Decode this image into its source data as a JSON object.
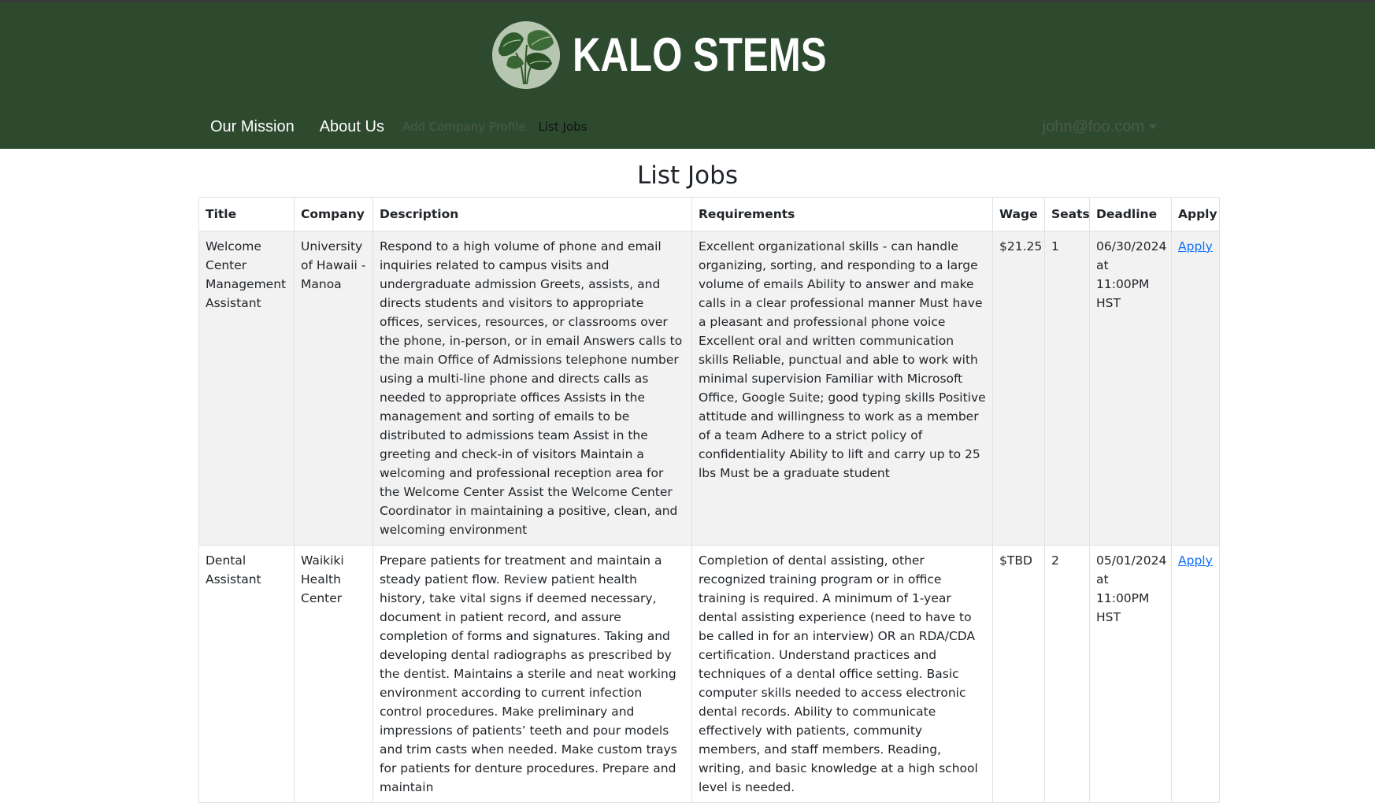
{
  "brand": {
    "name": "KALO STEMS",
    "logo_icon": "taro-leaf-icon"
  },
  "nav": {
    "our_mission": "Our Mission",
    "about_us": "About Us",
    "add_company_profile": "Add Company Profile",
    "list_jobs": "List Jobs",
    "user_email": "john@foo.com"
  },
  "page": {
    "title": "List Jobs"
  },
  "table": {
    "headers": [
      "Title",
      "Company",
      "Description",
      "Requirements",
      "Wage",
      "Seats",
      "Deadline",
      "Apply"
    ],
    "rows": [
      {
        "title": "Welcome Center Management Assistant",
        "company": "University of Hawaii - Manoa",
        "description": "Respond to a high volume of phone and email inquiries related to campus visits and undergraduate admission Greets, assists, and directs students and visitors to appropriate offices, services, resources, or classrooms over the phone, in-person, or in email Answers calls to the main Office of Admissions telephone number using a multi-line phone and directs calls as needed to appropriate offices Assists in the management and sorting of emails to be distributed to admissions team Assist in the greeting and check-in of visitors Maintain a welcoming and professional reception area for the Welcome Center Assist the Welcome Center Coordinator in maintaining a positive, clean, and welcoming environment",
        "requirements": "Excellent organizational skills - can handle organizing, sorting, and responding to a large volume of emails Ability to answer and make calls in a clear professional manner Must have a pleasant and professional phone voice Excellent oral and written communication skills Reliable, punctual and able to work with minimal supervision Familiar with Microsoft Office, Google Suite; good typing skills Positive attitude and willingness to work as a member of a team Adhere to a strict policy of confidentiality Ability to lift and carry up to 25 lbs Must be a graduate student",
        "wage": "$21.25",
        "seats": "1",
        "deadline": "06/30/2024 at 11:00PM HST",
        "apply": "Apply"
      },
      {
        "title": "Dental Assistant",
        "company": "Waikiki Health Center",
        "description": "Prepare patients for treatment and maintain a steady patient flow. Review patient health history, take vital signs if deemed necessary, document in patient record, and assure completion of forms and signatures. Taking and developing dental radiographs as prescribed by the dentist. Maintains a sterile and neat working environment according to current infection control procedures. Make preliminary and impressions of patients’ teeth and pour models and trim casts when needed. Make custom trays for patients for denture procedures. Prepare and maintain",
        "requirements": "Completion of dental assisting, other recognized training program or in office training is required. A minimum of 1-year dental assisting experience (need to have to be called in for an interview) OR an RDA/CDA certification. Understand practices and techniques of a dental office setting. Basic computer skills needed to access electronic dental records. Ability to communicate effectively with patients, community members, and staff members. Reading, writing, and basic knowledge at a high school level is needed.",
        "wage": "$TBD",
        "seats": "2",
        "deadline": "05/01/2024 at 11:00PM HST",
        "apply": "Apply"
      }
    ]
  }
}
